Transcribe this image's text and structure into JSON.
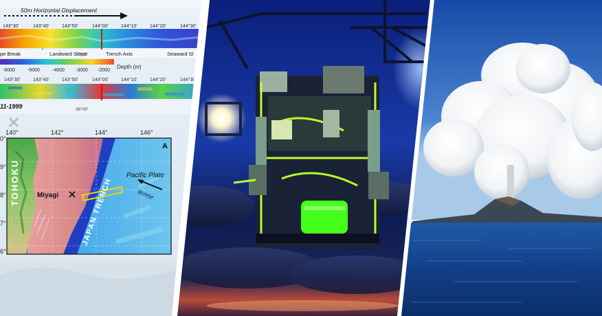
{
  "colors": {
    "separator": "#ffffff",
    "ocean_blue": "#1e6fd0",
    "sky_blue": "#1d5fb8",
    "rov_green": "#b8ff2a"
  },
  "map_panel": {
    "top_strip": {
      "displacement_label": "50m Horizontal Displacement",
      "top_ticks": [
        "143°30'",
        "143°40'",
        "143°50'",
        "144°00'",
        "144°10'",
        "144°20'",
        "144°30'"
      ],
      "annotations": [
        "pe Break",
        "Landward Slope",
        "Trench Axis",
        "Seaward Sl"
      ],
      "lat_label": "38°00'",
      "depth_ticks": [
        "-6000",
        "-5000",
        "-4000",
        "-3000",
        "-2000"
      ],
      "depth_unit": "Depth (m)",
      "lower_ticks": [
        "143°30'",
        "143°40'",
        "143°50'",
        "144°00'",
        "144°10'",
        "144°20'",
        "144°30'"
      ],
      "date_label": "11-1999",
      "lower_lat": "38°00'"
    },
    "inset_map": {
      "lon_ticks": [
        "140°",
        "142°",
        "144°",
        "146°"
      ],
      "lat_ticks": [
        "0°",
        "9°",
        "8°",
        "7°",
        "6°"
      ],
      "panel_letter": "A",
      "region_label": "TOHOKU",
      "prefecture_label": "Miyagi",
      "trench_label": "JAPAN TRENCH",
      "plate_label": "Pacific Plate",
      "rate_label": "8cm/yr"
    }
  }
}
